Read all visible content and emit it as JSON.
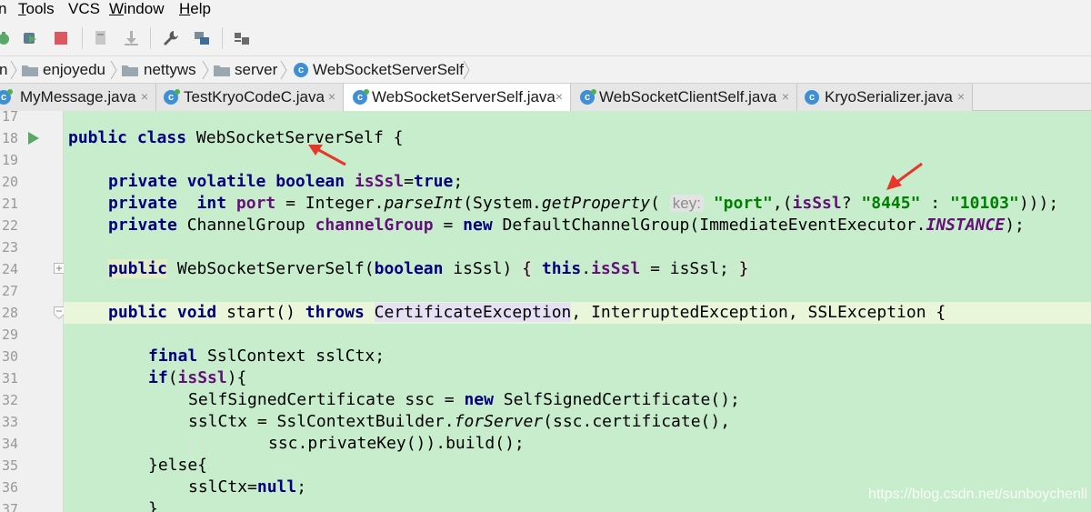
{
  "menubar": {
    "items": [
      {
        "label": "n",
        "underline": ""
      },
      {
        "label": "Tools",
        "underline": "T"
      },
      {
        "label": "VCS",
        "underline": ""
      },
      {
        "label": "Window",
        "underline": "W"
      },
      {
        "label": "Help",
        "underline": "H"
      }
    ]
  },
  "toolbar": {
    "icons": [
      "debug-icon",
      "coverage-icon",
      "stop-icon",
      "build-icon",
      "download-icon",
      "wrench-icon",
      "project-structure-icon",
      "layout-icon"
    ]
  },
  "breadcrumb": {
    "items": [
      "n",
      "enjoyedu",
      "nettyws",
      "server",
      "WebSocketServerSelf"
    ]
  },
  "tabs": [
    {
      "label": "MyMessage.java",
      "active": false
    },
    {
      "label": "TestKryoCodeC.java",
      "active": false
    },
    {
      "label": "WebSocketServerSelf.java",
      "active": true
    },
    {
      "label": "WebSocketClientSelf.java",
      "active": false
    },
    {
      "label": "KryoSerializer.java",
      "active": false
    }
  ],
  "gutter": {
    "line_numbers": [
      "17",
      "18",
      "19",
      "20",
      "21",
      "22",
      "23",
      "24",
      "27",
      "28",
      "29",
      "30",
      "31",
      "32",
      "33",
      "34",
      "35",
      "36",
      "37"
    ]
  },
  "code": {
    "l18": {
      "kw1": "public",
      "kw2": "class",
      "rest": " WebSocketServerSelf {"
    },
    "l20": {
      "kw1": "private",
      "kw2": "volatile",
      "kw3": "boolean",
      "field": "isSsl",
      "eq": "=",
      "val": "true",
      "end": ";"
    },
    "l21": {
      "kw1": "private",
      "kw2": "int",
      "field": "port",
      "mid": " = Integer.",
      "method": "parseInt",
      "mid2": "(System.",
      "method2": "getProperty",
      "open": "(",
      "hint": "key:",
      "str1": "\"port\"",
      "comma": ",(",
      "field2": "isSsl",
      "q": "? ",
      "str2": "\"8445\"",
      "colon": " : ",
      "str3": "\"10103\"",
      "end": ")));"
    },
    "l22": {
      "kw1": "private",
      "type": " ChannelGroup ",
      "field": "channelGroup",
      "eq": " = ",
      "kw2": "new",
      "mid": " DefaultChannelGroup(ImmediateEventExecutor.",
      "static": "INSTANCE",
      "end": ");"
    },
    "l24": {
      "kw1": "public",
      "mid": " WebSocketServerSelf(",
      "kw2": "boolean",
      "mid2": " isSsl) ",
      "brace1": "{",
      "sp": " ",
      "kw3": "this",
      "dot": ".",
      "field": "isSsl",
      "mid3": " = isSsl; ",
      "brace2": "}"
    },
    "l28": {
      "kw1": "public",
      "kw2": "void",
      "mid": " start() ",
      "kw3": "throws",
      "sp": " ",
      "exc1": "CertificateException",
      "rest": ", InterruptedException, SSLException {"
    },
    "l30": {
      "kw1": "final",
      "rest": " SslContext sslCtx;"
    },
    "l31": {
      "kw1": "if",
      "open": "(",
      "field": "isSsl",
      "end": "){"
    },
    "l32": {
      "mid": "SelfSignedCertificate ssc = ",
      "kw1": "new",
      "end": " SelfSignedCertificate();"
    },
    "l33": {
      "mid": "sslCtx = SslContextBuilder.",
      "method": "forServer",
      "end": "(ssc.certificate(),"
    },
    "l34": {
      "text": "ssc.privateKey()).build();"
    },
    "l35": {
      "text": "}else{"
    },
    "l36": {
      "mid": "sslCtx=",
      "kw1": "null",
      "end": ";"
    },
    "l37": {
      "text": "}"
    }
  },
  "watermark": "https://blog.csdn.net/sunboychenll",
  "colors": {
    "editor_bg": "#c7edcc",
    "keyword": "#000080",
    "field": "#660e7a",
    "string": "#008000",
    "arrow": "#e8362a"
  }
}
